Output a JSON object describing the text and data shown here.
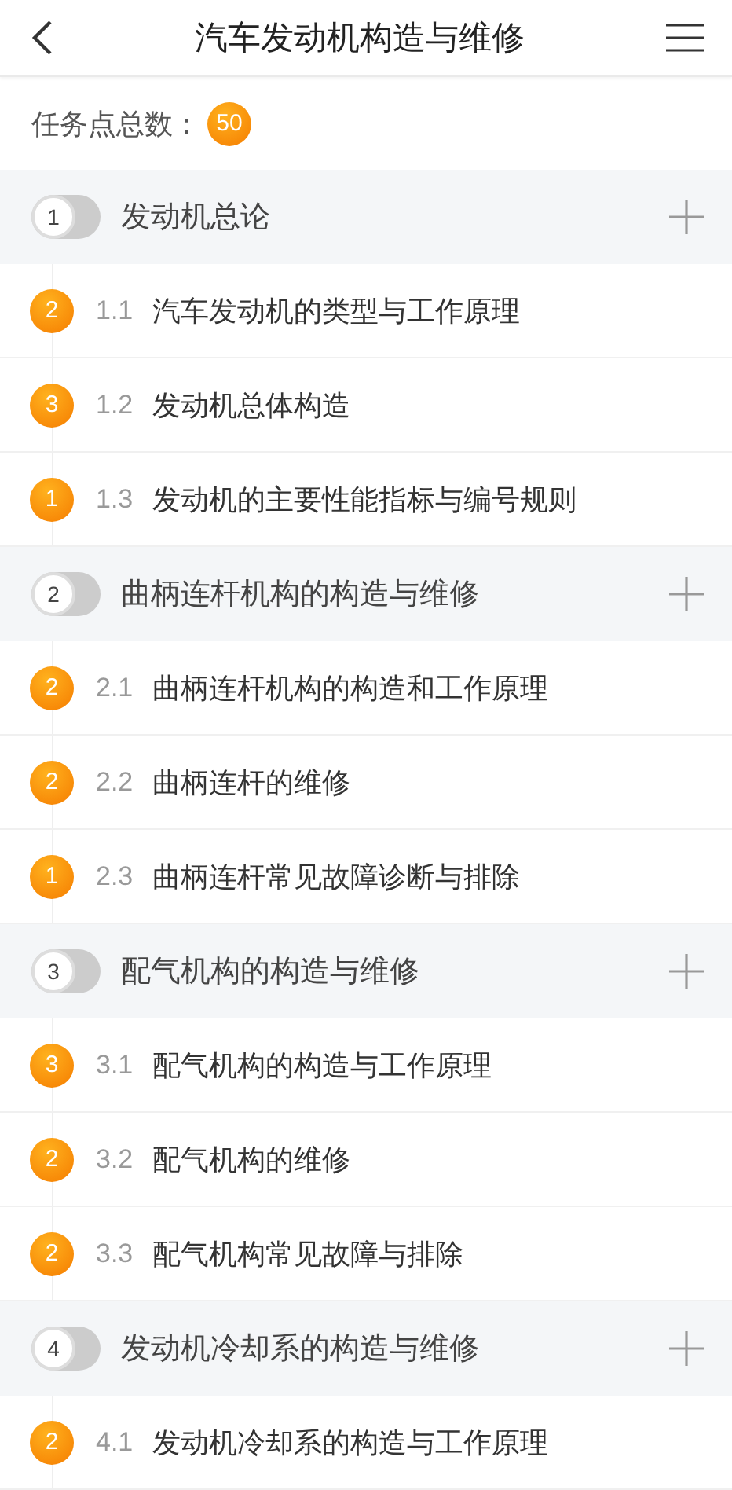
{
  "header": {
    "title": "汽车发动机构造与维修"
  },
  "summary": {
    "label": "任务点总数：",
    "count": "50"
  },
  "chapters": [
    {
      "number": "1",
      "title": "发动机总论",
      "lessons": [
        {
          "count": "2",
          "number": "1.1",
          "title": "汽车发动机的类型与工作原理"
        },
        {
          "count": "3",
          "number": "1.2",
          "title": "发动机总体构造"
        },
        {
          "count": "1",
          "number": "1.3",
          "title": "发动机的主要性能指标与编号规则"
        }
      ]
    },
    {
      "number": "2",
      "title": "曲柄连杆机构的构造与维修",
      "lessons": [
        {
          "count": "2",
          "number": "2.1",
          "title": "曲柄连杆机构的构造和工作原理"
        },
        {
          "count": "2",
          "number": "2.2",
          "title": "曲柄连杆的维修"
        },
        {
          "count": "1",
          "number": "2.3",
          "title": "曲柄连杆常见故障诊断与排除"
        }
      ]
    },
    {
      "number": "3",
      "title": "配气机构的构造与维修",
      "lessons": [
        {
          "count": "3",
          "number": "3.1",
          "title": "配气机构的构造与工作原理"
        },
        {
          "count": "2",
          "number": "3.2",
          "title": "配气机构的维修"
        },
        {
          "count": "2",
          "number": "3.3",
          "title": "配气机构常见故障与排除"
        }
      ]
    },
    {
      "number": "4",
      "title": "发动机冷却系的构造与维修",
      "lessons": [
        {
          "count": "2",
          "number": "4.1",
          "title": "发动机冷却系的构造与工作原理"
        }
      ]
    }
  ]
}
